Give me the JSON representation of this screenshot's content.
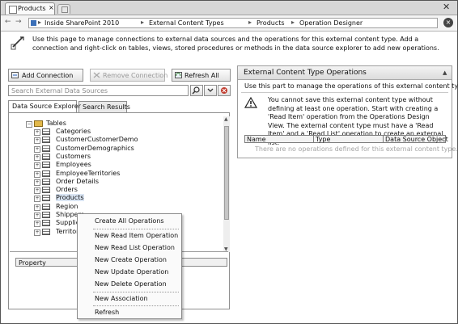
{
  "window": {
    "tab_label": "Products",
    "tab_close": "×",
    "close_glyph": "✕"
  },
  "nav": {
    "back": "←",
    "forward": "→",
    "breadcrumbs": [
      "Inside SharePoint 2010",
      "External Content Types",
      "Products",
      "Operation Designer"
    ],
    "separator": "▸",
    "close_glyph": "×"
  },
  "intro": {
    "text": "Use this page to manage connections to external data sources and the operations for this external content type. Add a connection and right-click on tables, views, stored procedures or methods in the data source explorer to add new operations."
  },
  "toolbar": {
    "add_connection": "Add Connection",
    "remove_connection": "Remove Connection",
    "refresh_all": "Refresh All"
  },
  "search": {
    "placeholder": "Search External Data Sources"
  },
  "explorer_tabs": {
    "data_source_explorer": "Data Source Explorer",
    "search_results": "Search Results"
  },
  "tree": {
    "root": "Tables",
    "items": [
      "Categories",
      "CustomerCustomerDemo",
      "CustomerDemographics",
      "Customers",
      "Employees",
      "EmployeeTerritories",
      "Order Details",
      "Orders",
      "Products",
      "Region",
      "Shippers",
      "Suppliers",
      "Territories"
    ]
  },
  "property": {
    "header": "Property"
  },
  "context_menu": {
    "items": [
      "Create All Operations",
      "New Read Item Operation",
      "New Read List Operation",
      "New Create Operation",
      "New Update Operation",
      "New Delete Operation",
      "New Association",
      "Refresh"
    ]
  },
  "operations_panel": {
    "title": "External Content Type Operations",
    "description": "Use this part to manage the operations of this external content type.",
    "warning": "You cannot save this external content type without defining at least one operation. Start with creating a 'Read Item' operation from the Operations Design View. The external content type must have a 'Read Item' and a 'Read List' operation to create an external list.",
    "columns": [
      "Name",
      "Type",
      "Data Source Object"
    ],
    "empty_text": "There are no operations defined for this external content type."
  }
}
